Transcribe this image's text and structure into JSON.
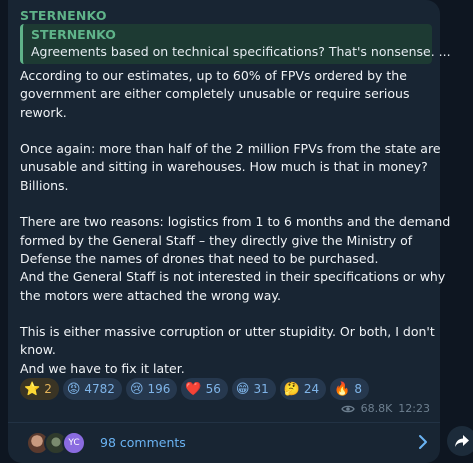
{
  "post": {
    "channel_name": "STERNENKO",
    "quote": {
      "author": "STERNENKO",
      "text": "Agreements based on technical specifications? That's nonsense. ..."
    },
    "body_lines": [
      "According to our estimates, up to 60% of FPVs ordered by the",
      "government are either completely unusable or require serious",
      "rework.",
      "",
      "Once again: more than half of the 2 million FPVs from the state are",
      "unusable and sitting in warehouses. How much is that in money?",
      "Billions.",
      "",
      "There are two reasons: logistics from 1 to 6 months and the demand",
      "formed by the General Staff – they directly give the Ministry of",
      "Defense the names of drones that need to be purchased.",
      "And the General Staff is not interested in their specifications or why",
      "the motors were attached the wrong way.",
      "",
      "This is either massive corruption or utter stupidity. Or both, I don't",
      "know.",
      "And we have to fix it later."
    ],
    "reactions": [
      {
        "emoji": "⭐",
        "count": "2"
      },
      {
        "emoji": "😡",
        "count": "4782"
      },
      {
        "emoji": "😢",
        "count": "196"
      },
      {
        "emoji": "❤️",
        "count": "56"
      },
      {
        "emoji": "😁",
        "count": "31"
      },
      {
        "emoji": "🤔",
        "count": "24"
      },
      {
        "emoji": "🔥",
        "count": "8"
      }
    ],
    "views": "68.8K",
    "time": "12:23",
    "views_icon": "eye-icon"
  },
  "comments": {
    "avatar_initials": "YC",
    "label": "98 comments",
    "chevron_icon": "chevron-right-icon"
  },
  "share_icon": "share-arrow-icon",
  "colors": {
    "background": "#0e1621",
    "bubble": "#182533",
    "accent_green": "#5fb389",
    "link_blue": "#6ab3f3",
    "meta_gray": "#6d7f8f"
  }
}
